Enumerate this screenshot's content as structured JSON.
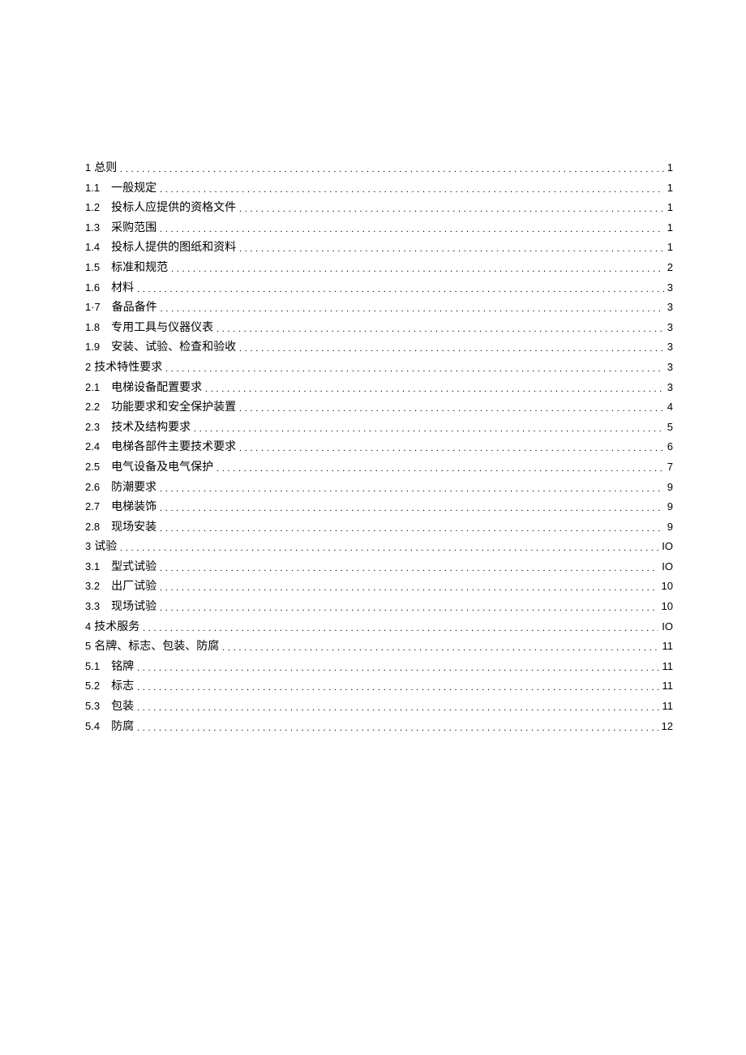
{
  "toc": [
    {
      "level": 1,
      "num": "1",
      "text": "总则",
      "page": "1"
    },
    {
      "level": 2,
      "num": "1.1",
      "text": "一般规定",
      "page": "1"
    },
    {
      "level": 2,
      "num": "1.2",
      "text": "投标人应提供的资格文件",
      "page": "1"
    },
    {
      "level": 2,
      "num": "1.3",
      "text": "采购范围",
      "page": "1"
    },
    {
      "level": 2,
      "num": "1.4",
      "text": "投标人提供的图纸和资料",
      "page": "1"
    },
    {
      "level": 2,
      "num": "1.5",
      "text": "标准和规范",
      "page": "2"
    },
    {
      "level": 2,
      "num": "1.6",
      "text": "材料",
      "page": "3"
    },
    {
      "level": 2,
      "num": "1·7",
      "text": "备品备件",
      "page": "3"
    },
    {
      "level": 2,
      "num": "1.8",
      "text": "专用工具与仪器仪表",
      "page": "3"
    },
    {
      "level": 2,
      "num": "1.9",
      "text": "安装、试验、检查和验收",
      "page": "3"
    },
    {
      "level": 1,
      "num": "2",
      "text": "技术特性要求",
      "page": "3"
    },
    {
      "level": 2,
      "num": "2.1",
      "text": "电梯设备配置要求",
      "page": "3"
    },
    {
      "level": 2,
      "num": "2.2",
      "text": "功能要求和安全保护装置",
      "page": "4"
    },
    {
      "level": 2,
      "num": "2.3",
      "text": "技术及结构要求",
      "page": "5"
    },
    {
      "level": 2,
      "num": "2.4",
      "text": "电梯各部件主要技术要求",
      "page": "6"
    },
    {
      "level": 2,
      "num": "2.5",
      "text": "电气设备及电气保护",
      "page": "7"
    },
    {
      "level": 2,
      "num": "2.6",
      "text": "防潮要求",
      "page": "9"
    },
    {
      "level": 2,
      "num": "2.7",
      "text": "电梯装饰",
      "page": "9"
    },
    {
      "level": 2,
      "num": "2.8",
      "text": "现场安装",
      "page": "9"
    },
    {
      "level": 1,
      "num": "3",
      "text": "试验",
      "page": "IO"
    },
    {
      "level": 2,
      "num": "3.1",
      "text": "型式试验",
      "page": "IO"
    },
    {
      "level": 2,
      "num": "3.2",
      "text": "出厂试验",
      "page": "10"
    },
    {
      "level": 2,
      "num": "3.3",
      "text": "现场试验",
      "page": "10"
    },
    {
      "level": 1,
      "num": "4",
      "text": "技术服务",
      "page": "IO"
    },
    {
      "level": 1,
      "num": "5",
      "text": "名牌、标志、包装、防腐",
      "page": "11"
    },
    {
      "level": 2,
      "num": "5.1",
      "text": "铭牌",
      "page": "11"
    },
    {
      "level": 2,
      "num": "5.2",
      "text": "标志",
      "page": "11"
    },
    {
      "level": 2,
      "num": "5.3",
      "text": "包装",
      "page": "11"
    },
    {
      "level": 2,
      "num": "5.4",
      "text": "防腐",
      "page": "12"
    }
  ]
}
